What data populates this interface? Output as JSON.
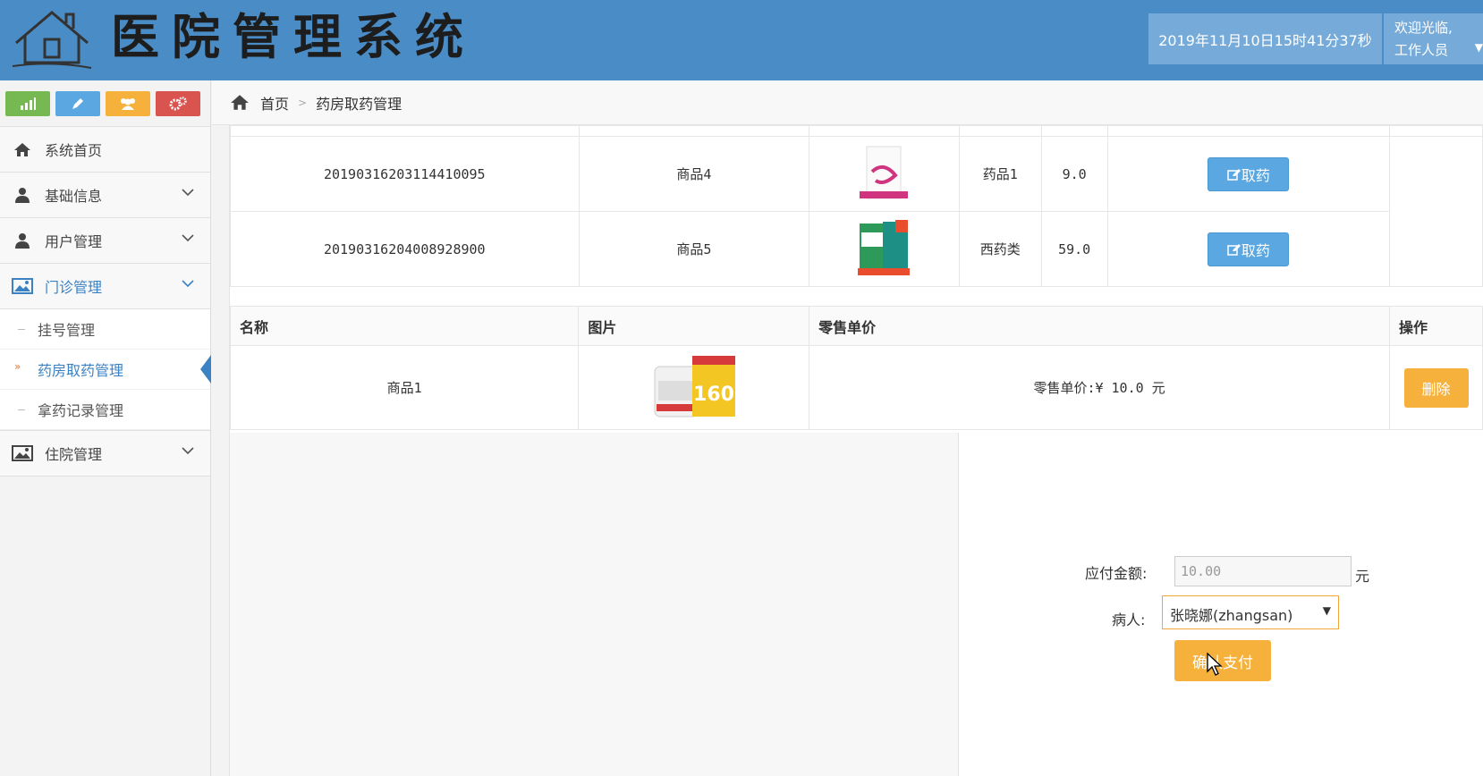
{
  "header": {
    "title": "医院管理系统",
    "datetime": "2019年11月10日15时41分37秒",
    "welcome_line1": "欢迎光临,",
    "welcome_line2": "工作人员"
  },
  "sidebar": {
    "shortcuts": [
      "chart-icon",
      "pencil-icon",
      "users-icon",
      "gears-icon"
    ],
    "items": [
      {
        "label": "系统首页",
        "icon": "home-icon"
      },
      {
        "label": "基础信息",
        "icon": "user-icon"
      },
      {
        "label": "用户管理",
        "icon": "user-icon"
      },
      {
        "label": "门诊管理",
        "icon": "picture-icon"
      },
      {
        "label": "住院管理",
        "icon": "picture-icon"
      }
    ],
    "sub_items": [
      {
        "label": "挂号管理"
      },
      {
        "label": "药房取药管理"
      },
      {
        "label": "拿药记录管理"
      }
    ]
  },
  "breadcrumb": {
    "home": "首页",
    "current": "药房取药管理"
  },
  "orders": {
    "rows": [
      {
        "id": "20190316203114410095",
        "name": "商品4",
        "category": "药品1",
        "price": "9.0",
        "action": "取药"
      },
      {
        "id": "20190316204008928900",
        "name": "商品5",
        "category": "西药类",
        "price": "59.0",
        "action": "取药"
      }
    ]
  },
  "cart": {
    "headers": {
      "name": "名称",
      "image": "图片",
      "price": "零售单价",
      "action": "操作"
    },
    "rows": [
      {
        "name": "商品1",
        "price_text": "零售单价:¥ 10.0 元",
        "action": "删除"
      }
    ]
  },
  "payment": {
    "amount_label": "应付金额:",
    "amount_value": "10.00",
    "amount_unit": "元",
    "patient_label": "病人:",
    "patient_value": "张晓娜(zhangsan)",
    "confirm_label": "确认支付"
  },
  "colors": {
    "header": "#4a8cc6",
    "primary_button": "#5aa7e2",
    "warning_button": "#f6b13c",
    "active_nav": "#3a82c4"
  }
}
